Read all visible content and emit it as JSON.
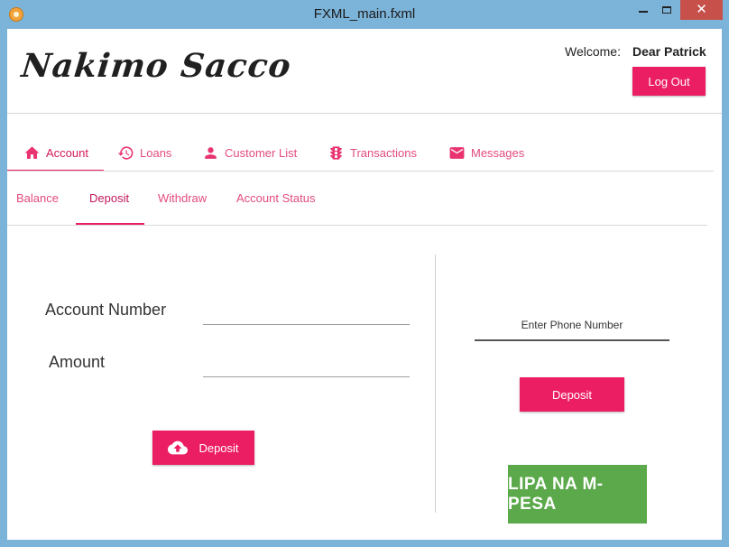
{
  "window": {
    "title": "FXML_main.fxml",
    "close_glyph": "✕"
  },
  "header": {
    "brand": "Nakimo Sacco",
    "welcome_label": "Welcome:",
    "user_name": "Dear Patrick",
    "logout_label": "Log Out"
  },
  "tabs": [
    {
      "label": "Account",
      "icon": "home-icon",
      "active": true
    },
    {
      "label": "Loans",
      "icon": "history-icon"
    },
    {
      "label": "Customer List",
      "icon": "person-icon"
    },
    {
      "label": "Transactions",
      "icon": "traffic-icon"
    },
    {
      "label": "Messages",
      "icon": "mail-icon"
    }
  ],
  "subtabs": [
    {
      "label": "Balance"
    },
    {
      "label": "Deposit",
      "active": true
    },
    {
      "label": "Withdraw"
    },
    {
      "label": "Account Status"
    }
  ],
  "form": {
    "account_number_label": "Account Number",
    "amount_label": "Amount",
    "deposit_button": "Deposit"
  },
  "mobile": {
    "phone_placeholder": "Enter Phone Number",
    "deposit_button": "Deposit",
    "logo_text": "LIPA NA M-PESA"
  },
  "colors": {
    "accent": "#ec1e63",
    "mpesa_green": "#5ba94a",
    "titlebar": "#7cb3d9"
  }
}
